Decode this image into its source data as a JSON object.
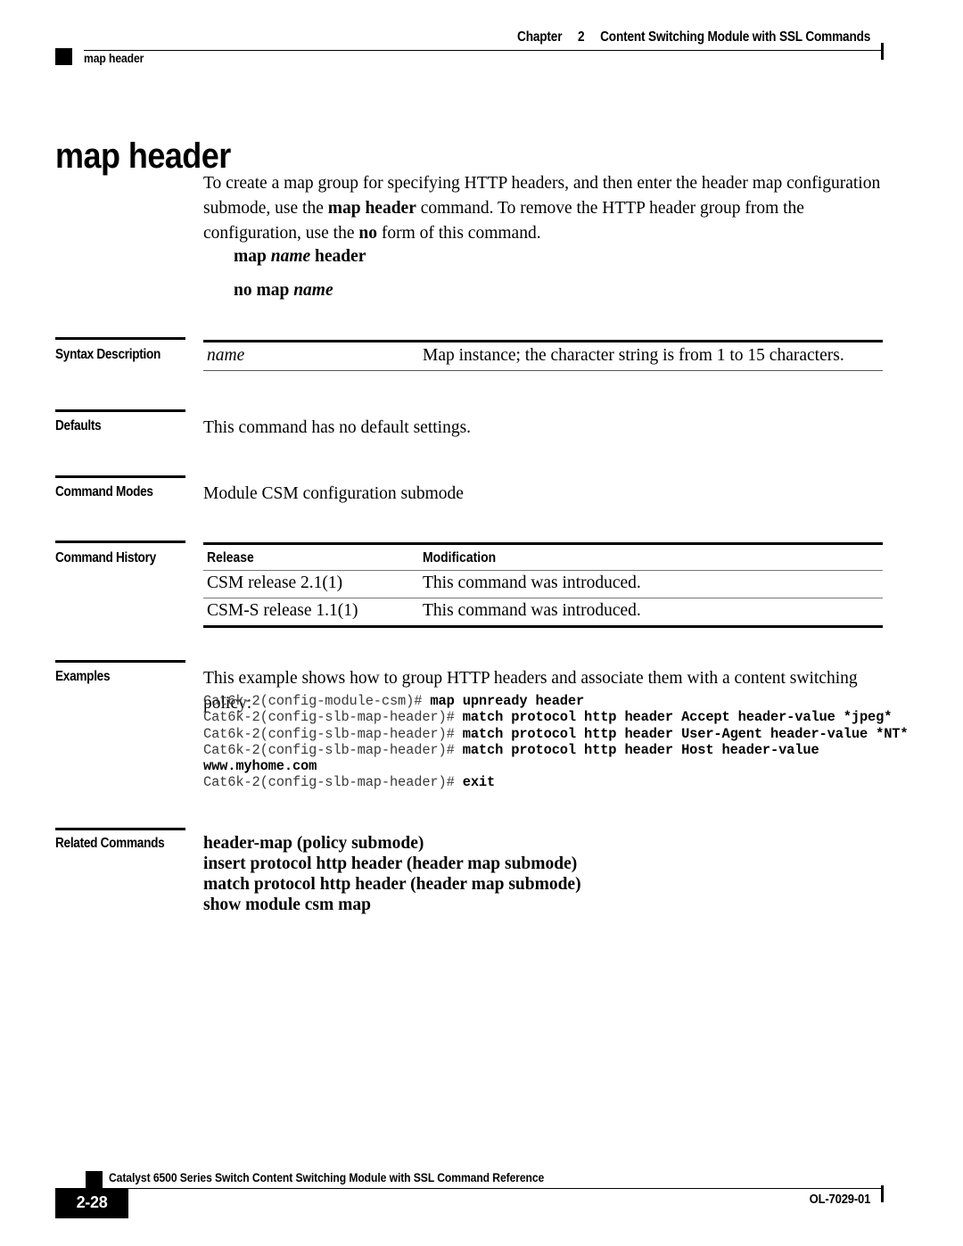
{
  "header": {
    "chapter_label": "Chapter",
    "chapter_number": "2",
    "chapter_title": "Content Switching Module with SSL Commands",
    "running_head": "map header"
  },
  "page": {
    "title": "map header"
  },
  "intro": {
    "part1": "To create a map group for specifying HTTP headers, and then enter the header map configuration submode, use the ",
    "bold1": "map header",
    "part2": " command. To remove the HTTP header group from the configuration, use the ",
    "bold2": "no",
    "part3": " form of this command."
  },
  "syntax_lines": {
    "line1_pre": "map ",
    "line1_var": "name",
    "line1_post": " header",
    "line2_pre": "no map ",
    "line2_var": "name"
  },
  "sections": {
    "syntax_description": "Syntax Description",
    "defaults": "Defaults",
    "command_modes": "Command Modes",
    "command_history": "Command History",
    "examples": "Examples",
    "related_commands": "Related Commands"
  },
  "syntax_description": {
    "term": "name",
    "description": "Map instance; the character string is from 1 to 15 characters."
  },
  "defaults": {
    "text": "This command has no default settings."
  },
  "command_modes": {
    "text": "Module CSM configuration submode"
  },
  "command_history": {
    "columns": [
      "Release",
      "Modification"
    ],
    "rows": [
      [
        "CSM release 2.1(1)",
        "This command was introduced."
      ],
      [
        "CSM-S release 1.1(1)",
        "This command was introduced."
      ]
    ]
  },
  "examples": {
    "intro": "This example shows how to group HTTP headers and associate them with a content switching policy:",
    "lines": [
      {
        "prompt": "Cat6k-2(config-module-csm)# ",
        "command": "map upnready header"
      },
      {
        "prompt": "Cat6k-2(config-slb-map-header)# ",
        "command": "match protocol http header Accept header-value *jpeg*"
      },
      {
        "prompt": "Cat6k-2(config-slb-map-header)# ",
        "command": "match protocol http header User-Agent header-value *NT*"
      },
      {
        "prompt": "Cat6k-2(config-slb-map-header)# ",
        "command": "match protocol http header Host header-value"
      },
      {
        "prompt": "",
        "command": "www.myhome.com"
      },
      {
        "prompt": "Cat6k-2(config-slb-map-header)# ",
        "command": "exit"
      }
    ]
  },
  "related_commands": {
    "items": [
      "header-map (policy submode)",
      "insert protocol http header (header map submode)",
      "match protocol http header (header map submode)",
      "show module csm map"
    ]
  },
  "footer": {
    "page_number": "2-28",
    "book_title": "Catalyst 6500 Series Switch Content Switching Module with SSL Command Reference",
    "document_id": "OL-7029-01"
  }
}
